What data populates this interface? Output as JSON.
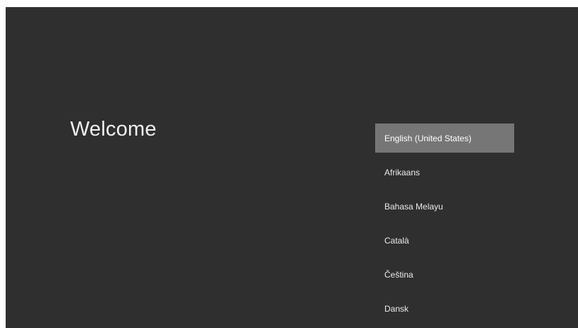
{
  "welcome_title": "Welcome",
  "languages": [
    {
      "label": "English (United States)",
      "selected": true
    },
    {
      "label": "Afrikaans",
      "selected": false
    },
    {
      "label": "Bahasa Melayu",
      "selected": false
    },
    {
      "label": "Català",
      "selected": false
    },
    {
      "label": "Čeština",
      "selected": false
    },
    {
      "label": "Dansk",
      "selected": false
    }
  ],
  "colors": {
    "background": "#2f2f2f",
    "selected_item": "#767676",
    "text": "#f0f0f0"
  }
}
